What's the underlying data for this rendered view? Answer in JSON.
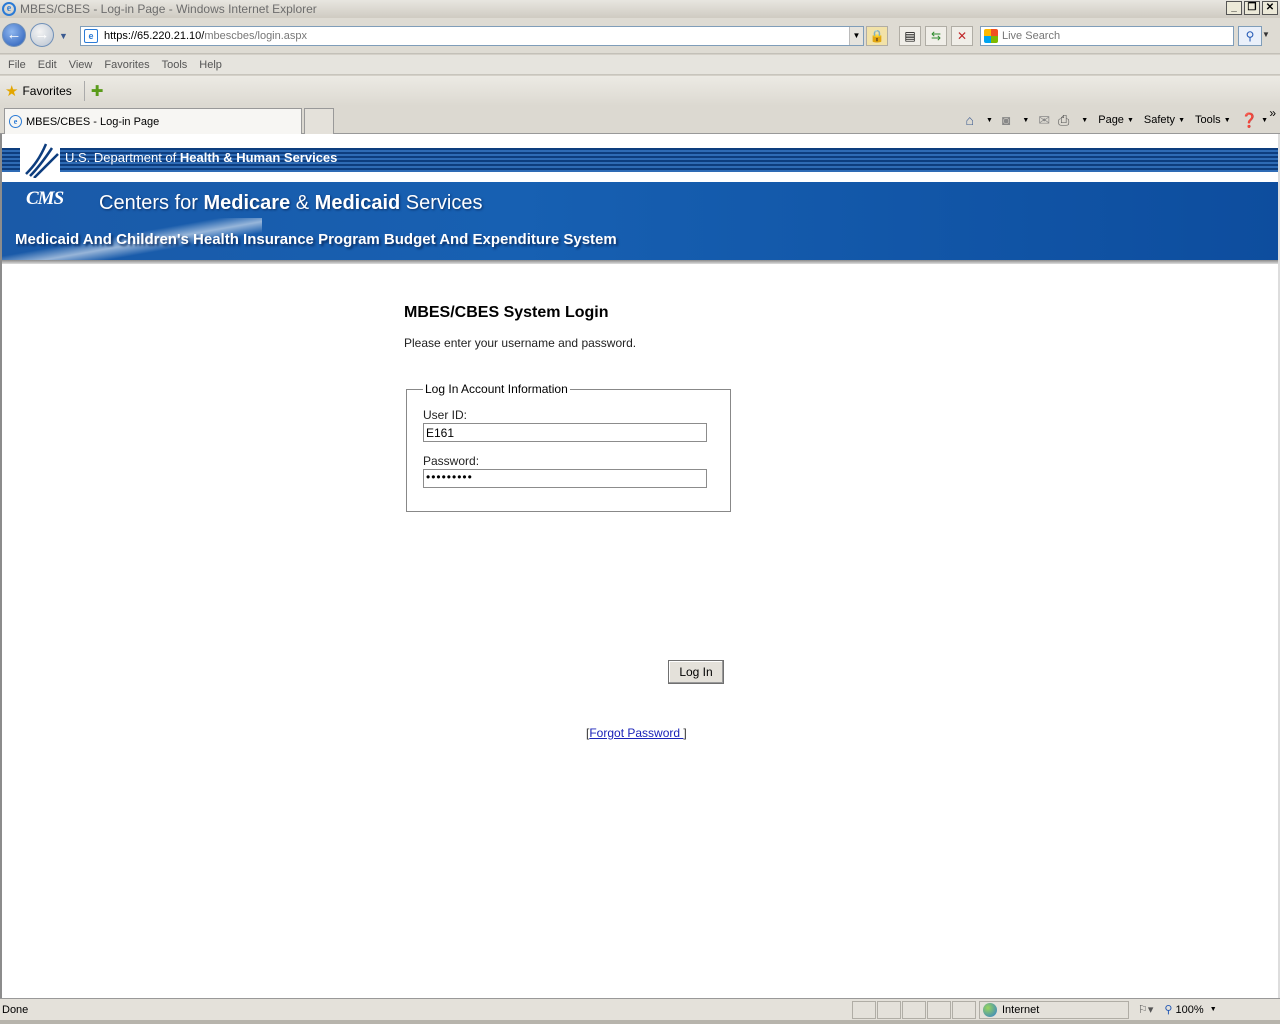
{
  "window": {
    "title": "MBES/CBES - Log-in Page - Windows Internet Explorer",
    "min": "_",
    "max": "❐",
    "close": "✕"
  },
  "address": {
    "url_host": "https://65.220.21.10/",
    "url_path": "mbescbes/login.aspx"
  },
  "search": {
    "placeholder": "Live Search"
  },
  "menu": [
    "File",
    "Edit",
    "View",
    "Favorites",
    "Tools",
    "Help"
  ],
  "favorites": {
    "label": "Favorites"
  },
  "tab": {
    "label": "MBES/CBES - Log-in Page"
  },
  "commandbar": {
    "page": "Page",
    "safety": "Safety",
    "tools": "Tools"
  },
  "header": {
    "hhs_prefix": "U.S. Department of ",
    "hhs_bold": "Health & Human Services",
    "cms_logo": "CMS",
    "cms_pre": "Centers for ",
    "cms_medicare": "Medicare",
    "cms_amp": " & ",
    "cms_medicaid": "Medicaid",
    "cms_post": " Services",
    "subtitle": "Medicaid And Children's Health Insurance Program Budget And Expenditure System"
  },
  "login": {
    "title": "MBES/CBES System Login",
    "instructions": "Please enter your username and password.",
    "legend": "Log In Account Information",
    "userid_label": "User ID:",
    "userid_value": "E161",
    "password_label": "Password:",
    "password_value": "•••••••••",
    "button": "Log In",
    "forgot_open": "[",
    "forgot": "Forgot Password ",
    "forgot_close": "]"
  },
  "status": {
    "text": "Done",
    "zone": "Internet",
    "zoom": "100%"
  }
}
